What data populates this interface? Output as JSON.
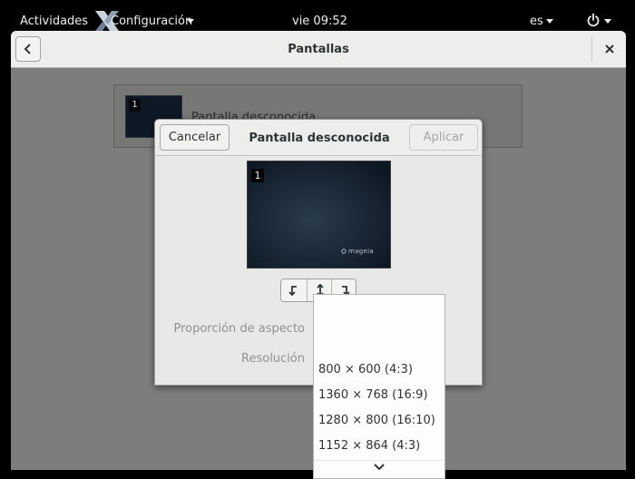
{
  "topbar": {
    "activities": "Actividades",
    "app_menu": "Configuración",
    "clock": "vie 09:52",
    "language": "es"
  },
  "window": {
    "title": "Pantallas",
    "monitor_card": {
      "number": "1",
      "name": "Pantalla desconocida"
    }
  },
  "dialog": {
    "cancel_label": "Cancelar",
    "title": "Pantalla desconocida",
    "apply_label": "Aplicar",
    "preview_number": "1",
    "preview_brand": "mageia",
    "aspect_label": "Proporción de aspecto",
    "resolution_label": "Resolución"
  },
  "dropdown": {
    "options": [
      "800 × 600 (4:3)",
      "1360 × 768 (16:9)",
      "1280 × 800 (16:10)",
      "1152 × 864 (4:3)"
    ]
  },
  "colors": {
    "topbar_bg": "#000000",
    "window_bg": "#7d7d7c",
    "headerbar_bg": "#ededeb",
    "preview_bg": "#121e2b"
  },
  "icons": [
    "app-x-logo-icon",
    "power-icon",
    "back-arrow-icon",
    "close-icon",
    "rotate-left-icon",
    "flip-icon",
    "rotate-right-icon",
    "chevron-down-icon"
  ]
}
